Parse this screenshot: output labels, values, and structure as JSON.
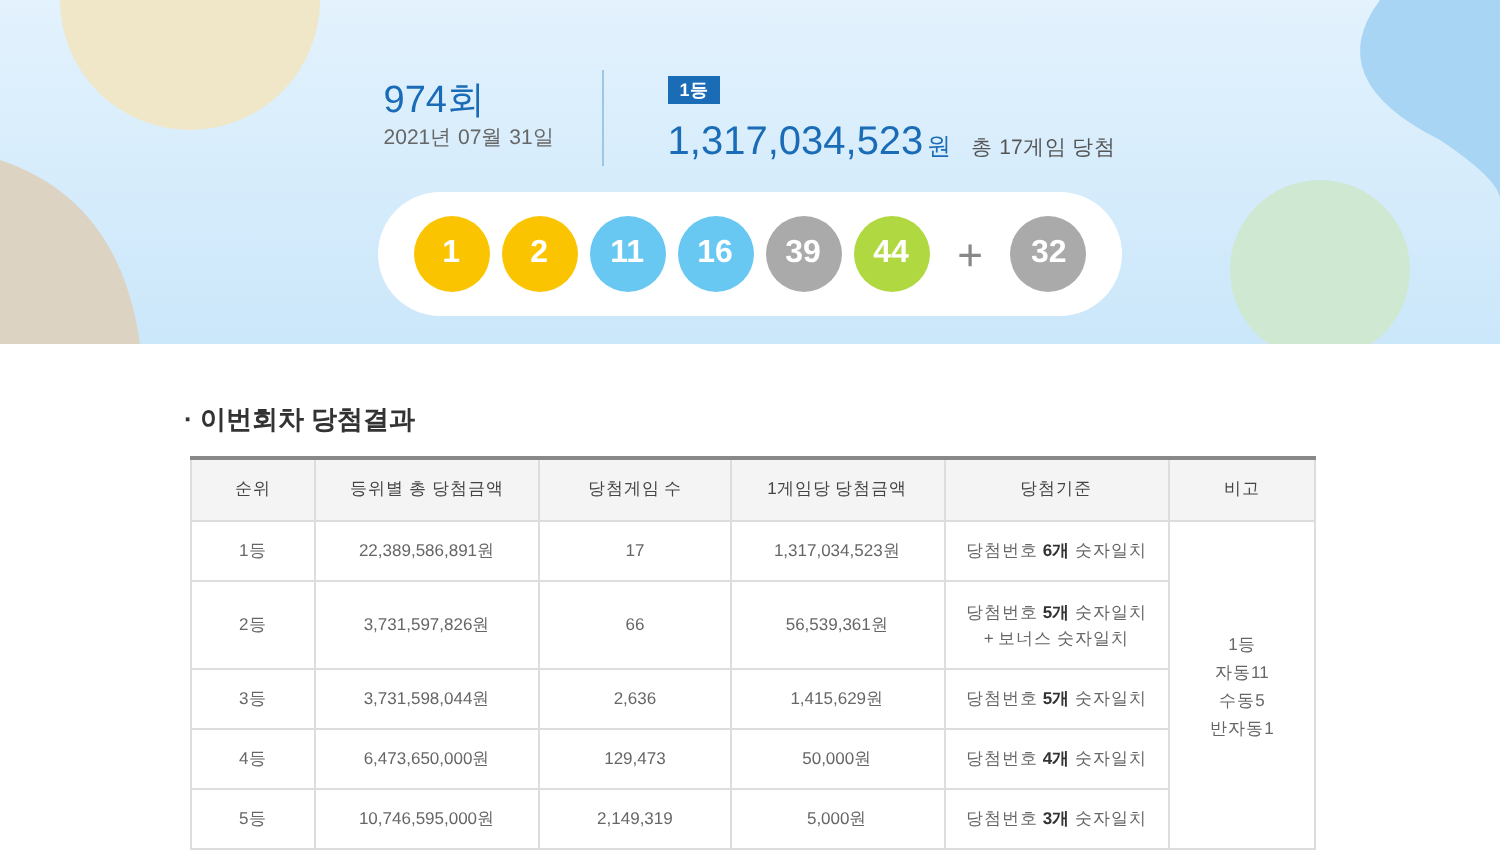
{
  "draw": {
    "round": "974회",
    "date": "2021년 07월 31일",
    "rank_badge": "1등",
    "prize": "1,317,034,523",
    "prize_unit": "원",
    "winners": "총 17게임 당첨",
    "balls": [
      {
        "number": "1",
        "color": "#fbc400"
      },
      {
        "number": "2",
        "color": "#fbc400"
      },
      {
        "number": "11",
        "color": "#69c8f2"
      },
      {
        "number": "16",
        "color": "#69c8f2"
      },
      {
        "number": "39",
        "color": "#aaaaaa"
      },
      {
        "number": "44",
        "color": "#b0d840"
      }
    ],
    "plus": "+",
    "bonus": {
      "number": "32",
      "color": "#aaaaaa"
    }
  },
  "section_title": "· 이번회차 당첨결과",
  "table": {
    "columns": [
      "순위",
      "등위별 총 당첨금액",
      "당첨게임 수",
      "1게임당 당첨금액",
      "당첨기준",
      "비고"
    ],
    "rows": [
      {
        "rank": "1등",
        "total": "22,389,586,891원",
        "games": "17",
        "per_game": "1,317,034,523원",
        "criteria": [
          "당첨번호 **6개** 숫자일치"
        ]
      },
      {
        "rank": "2등",
        "total": "3,731,597,826원",
        "games": "66",
        "per_game": "56,539,361원",
        "criteria": [
          "당첨번호 **5개** 숫자일치",
          "+ 보너스 숫자일치"
        ]
      },
      {
        "rank": "3등",
        "total": "3,731,598,044원",
        "games": "2,636",
        "per_game": "1,415,629원",
        "criteria": [
          "당첨번호 **5개** 숫자일치"
        ]
      },
      {
        "rank": "4등",
        "total": "6,473,650,000원",
        "games": "129,473",
        "per_game": "50,000원",
        "criteria": [
          "당첨번호 **4개** 숫자일치"
        ]
      },
      {
        "rank": "5등",
        "total": "10,746,595,000원",
        "games": "2,149,319",
        "per_game": "5,000원",
        "criteria": [
          "당첨번호 **3개** 숫자일치"
        ]
      }
    ],
    "remarks": [
      "1등",
      "자동11",
      "수동5",
      "반자동1"
    ]
  }
}
